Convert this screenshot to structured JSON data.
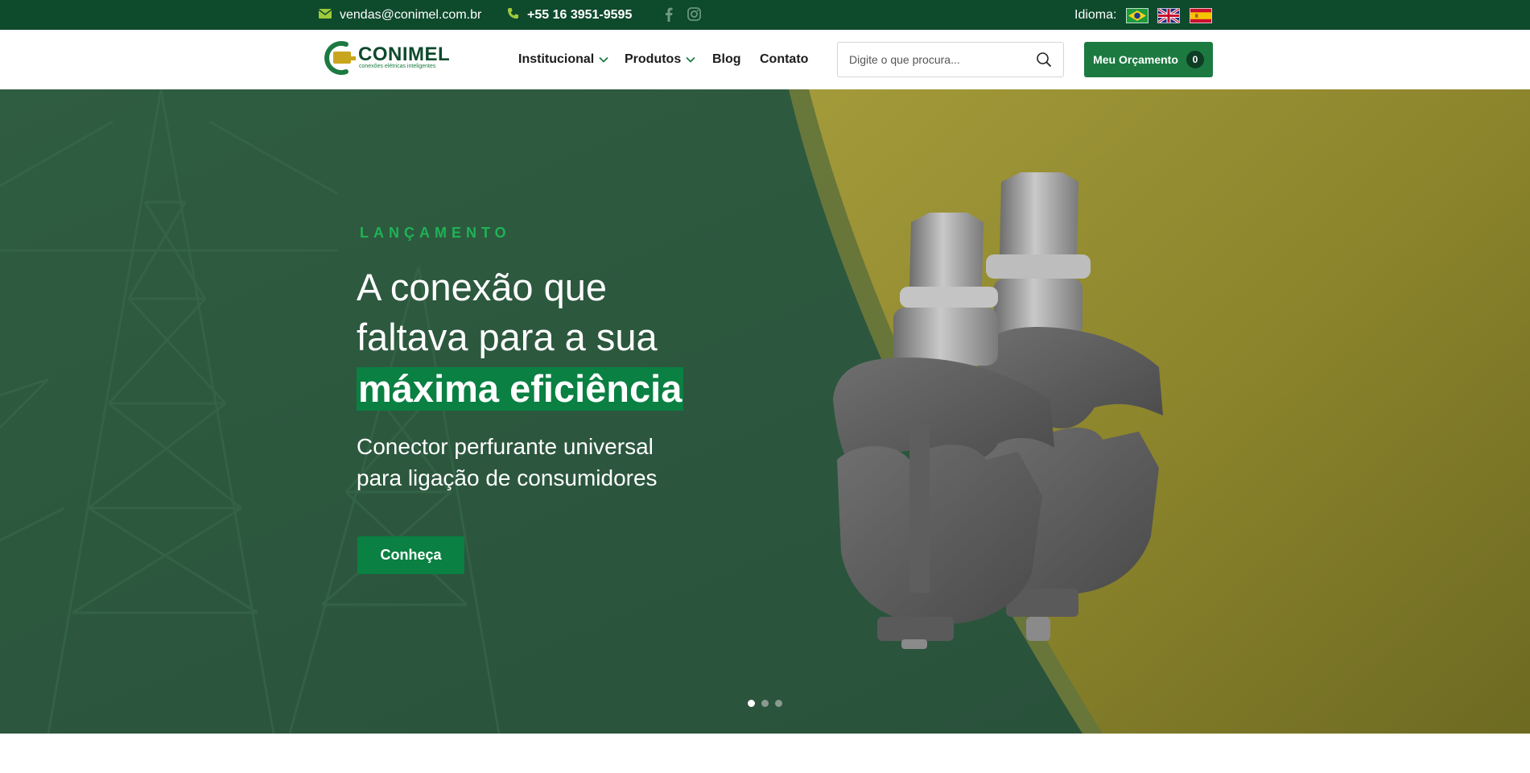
{
  "topbar": {
    "email": "vendas@conimel.com.br",
    "phone": "+55 16 3951-9595",
    "language_label": "Idioma:",
    "social": [
      "facebook-icon",
      "instagram-icon"
    ],
    "languages": [
      "Português (Brasil)",
      "English",
      "Español"
    ]
  },
  "header": {
    "logo_text": "CONIMEL",
    "logo_tagline": "conexões elétricas inteligentes",
    "nav": [
      {
        "label": "Institucional",
        "has_dropdown": true
      },
      {
        "label": "Produtos",
        "has_dropdown": true
      },
      {
        "label": "Blog",
        "has_dropdown": false
      },
      {
        "label": "Contato",
        "has_dropdown": false
      }
    ],
    "search_placeholder": "Digite o que procura...",
    "quote_button": "Meu Orçamento",
    "quote_count": "0"
  },
  "hero": {
    "eyebrow": "LANÇAMENTO",
    "title_line1": "A conexão que",
    "title_line2": "faltava para a sua",
    "title_highlight": "máxima eficiência",
    "subtitle_line1": "Conector perfurante universal",
    "subtitle_line2": "para ligação de consumidores",
    "button": "Conheça",
    "slides": 3,
    "active_slide": 1
  },
  "colors": {
    "topbar": "#0e4a2c",
    "accent": "#1c7a41",
    "hero_green": "#2d5a40",
    "hero_olive": "#8a8a2e",
    "highlight": "#0a8042"
  }
}
